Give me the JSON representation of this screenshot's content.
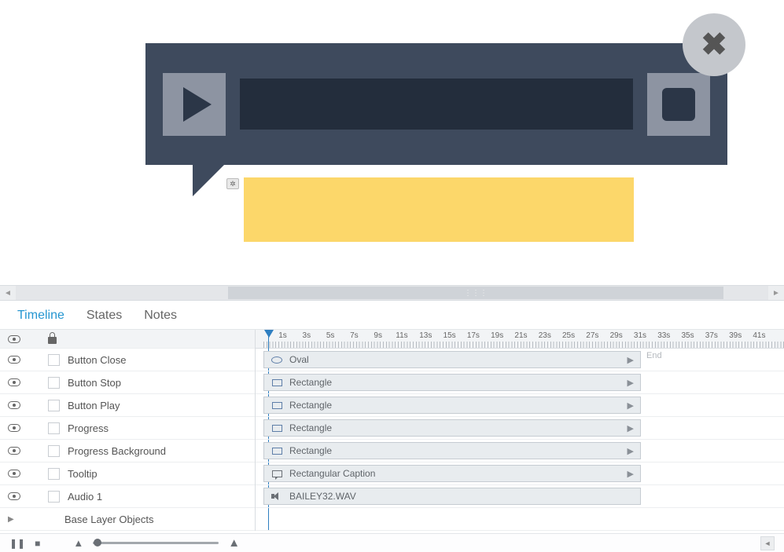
{
  "tabs": {
    "timeline": "Timeline",
    "states": "States",
    "notes": "Notes"
  },
  "ruler": {
    "labels": [
      "1s",
      "3s",
      "5s",
      "7s",
      "9s",
      "11s",
      "13s",
      "15s",
      "17s",
      "19s",
      "21s",
      "23s",
      "25s",
      "27s",
      "29s",
      "31s",
      "33s",
      "35s",
      "37s",
      "39s",
      "41s"
    ],
    "end_label": "End"
  },
  "layers": [
    {
      "name": "Button Close",
      "clip": "Oval",
      "icon": "oval",
      "arrow": true
    },
    {
      "name": "Button Stop",
      "clip": "Rectangle",
      "icon": "rect",
      "arrow": true
    },
    {
      "name": "Button Play",
      "clip": "Rectangle",
      "icon": "rect",
      "arrow": true
    },
    {
      "name": "Progress",
      "clip": "Rectangle",
      "icon": "rect",
      "arrow": true
    },
    {
      "name": "Progress Background",
      "clip": "Rectangle",
      "icon": "rect",
      "arrow": true
    },
    {
      "name": "Tooltip",
      "clip": "Rectangular Caption",
      "icon": "caption",
      "arrow": true
    },
    {
      "name": "Audio 1",
      "clip": "BAILEY32.WAV",
      "icon": "audio",
      "arrow": false
    }
  ],
  "base_layer": "Base Layer Objects"
}
